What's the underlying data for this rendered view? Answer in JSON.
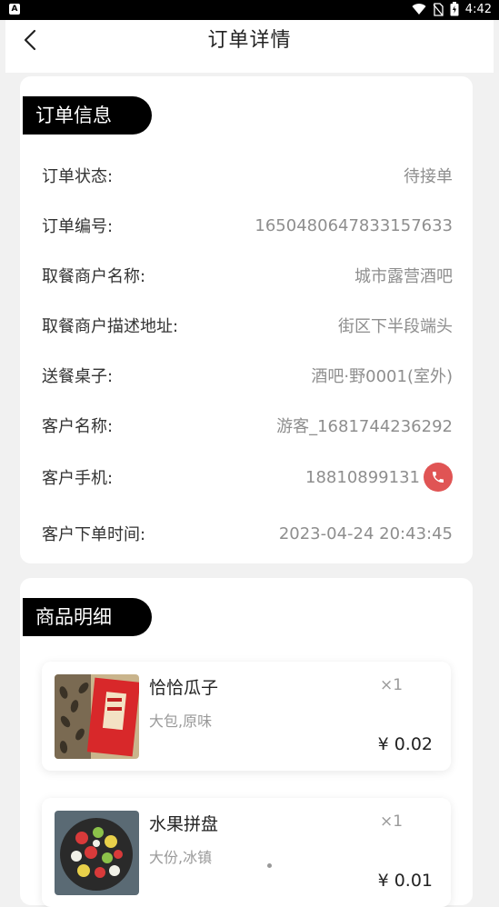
{
  "status_bar": {
    "time": "4:42",
    "app_badge": "A"
  },
  "header": {
    "title": "订单详情"
  },
  "order_info": {
    "section_title": "订单信息",
    "rows": [
      {
        "label": "订单状态:",
        "value": "待接单"
      },
      {
        "label": "订单编号:",
        "value": "1650480647833157633"
      },
      {
        "label": "取餐商户名称:",
        "value": "城市露营酒吧"
      },
      {
        "label": "取餐商户描述地址:",
        "value": "街区下半段端头"
      },
      {
        "label": "送餐桌子:",
        "value": "酒吧·野0001(室外)"
      },
      {
        "label": "客户名称:",
        "value": "游客_1681744236292"
      },
      {
        "label": "客户手机:",
        "value": "18810899131"
      },
      {
        "label": "客户下单时间:",
        "value": "2023-04-24 20:43:45"
      }
    ]
  },
  "goods": {
    "section_title": "商品明细",
    "items": [
      {
        "name": "恰恰瓜子",
        "spec": "大包,原味",
        "qty": "×1",
        "price": "¥ 0.02"
      },
      {
        "name": "水果拼盘",
        "spec": "大份,冰镇",
        "qty": "×1",
        "price": "¥ 0.01"
      }
    ]
  },
  "colors": {
    "accent_red": "#e05454",
    "tag_bg": "#000000"
  },
  "icons": [
    "back-chevron-icon",
    "wifi-icon",
    "no-sim-icon",
    "battery-icon",
    "phone-icon"
  ]
}
